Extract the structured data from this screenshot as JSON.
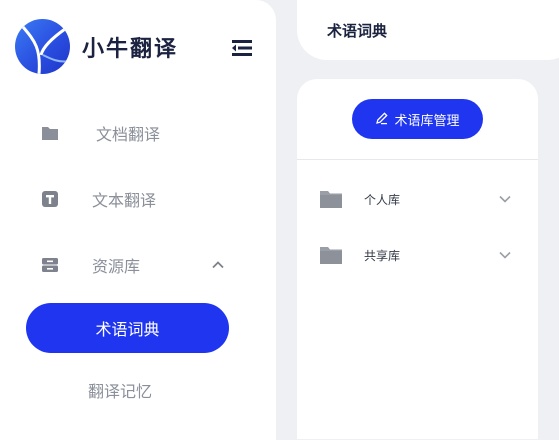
{
  "app": {
    "logo_text": "小牛翻译"
  },
  "sidebar": {
    "items": [
      {
        "label": "文档翻译",
        "icon": "folder-icon"
      },
      {
        "label": "文本翻译",
        "icon": "text-box-icon"
      },
      {
        "label": "资源库",
        "icon": "database-icon",
        "expanded": true
      }
    ],
    "active_item": {
      "label": "术语词典"
    },
    "sub_items": [
      {
        "label": "翻译记忆"
      }
    ]
  },
  "header": {
    "title": "术语词典"
  },
  "panel": {
    "manage_button": {
      "label": "术语库管理",
      "icon": "pencil-icon"
    },
    "libraries": [
      {
        "label": "个人库",
        "icon": "folder-icon"
      },
      {
        "label": "共享库",
        "icon": "folder-icon"
      }
    ]
  },
  "colors": {
    "accent": "#1f35f0",
    "background": "#eef0f4",
    "muted_text": "#8a8f99",
    "dark_text": "#1c2340"
  }
}
